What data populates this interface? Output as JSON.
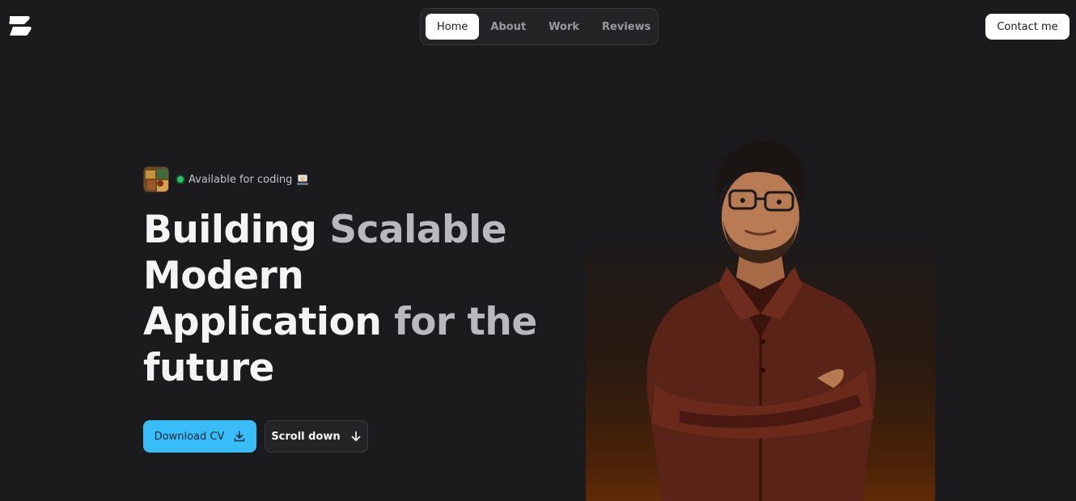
{
  "header": {
    "nav": [
      {
        "label": "Home",
        "active": true
      },
      {
        "label": "About",
        "active": false
      },
      {
        "label": "Work",
        "active": false
      },
      {
        "label": "Reviews",
        "active": false
      }
    ],
    "contact_label": "Contact me"
  },
  "hero": {
    "status_text": "Available for coding",
    "status_color": "#22c55e",
    "headline": {
      "line1_a": "Building",
      "line1_b": "Scalable",
      "line2": "Modern",
      "line3_a": "Application",
      "line3_b": "for the",
      "line4": "future"
    },
    "primary_button": {
      "label": "Download CV",
      "icon": "download-icon",
      "color": "#38bdf8"
    },
    "secondary_button": {
      "label": "Scroll down",
      "icon": "arrow-down-icon"
    }
  },
  "colors": {
    "background": "#1b1a1d",
    "accent": "#38bdf8"
  }
}
